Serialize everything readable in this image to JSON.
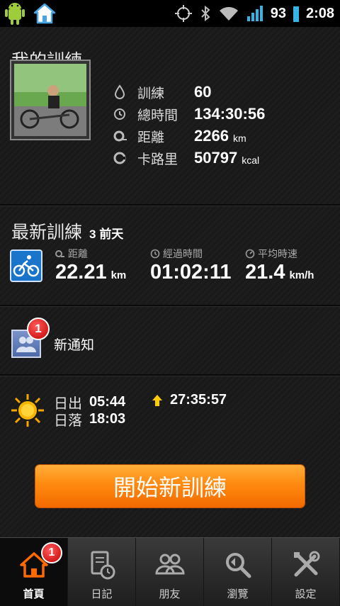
{
  "status_bar": {
    "battery": "93",
    "time": "2:08"
  },
  "my_training": {
    "title": "我的訓練",
    "stats": [
      {
        "label": "訓練",
        "value": "60",
        "unit": "",
        "icon": "drop-icon"
      },
      {
        "label": "總時間",
        "value": "134:30:56",
        "unit": "",
        "icon": "clock-icon"
      },
      {
        "label": "距離",
        "value": "2266",
        "unit": "km",
        "icon": "distance-icon"
      },
      {
        "label": "卡路里",
        "value": "50797",
        "unit": "kcal",
        "icon": "calorie-icon"
      }
    ]
  },
  "latest_training": {
    "title": "最新訓練",
    "ago": "3 前天",
    "metrics": [
      {
        "label": "距離",
        "value": "22.21",
        "unit": "km"
      },
      {
        "label": "經過時間",
        "value": "01:02:11",
        "unit": ""
      },
      {
        "label": "平均時速",
        "value": "21.4",
        "unit": "km/h"
      }
    ]
  },
  "notifications": {
    "label": "新通知",
    "badge": "1"
  },
  "sun": {
    "sunrise_label": "日出",
    "sunrise": "05:44",
    "sunset_label": "日落",
    "sunset": "18:03",
    "daylight": "27:35:57"
  },
  "start_button": "開始新訓練",
  "tabs": [
    {
      "label": "首頁",
      "badge": "1",
      "icon": "home-icon",
      "active": true
    },
    {
      "label": "日記",
      "icon": "diary-icon"
    },
    {
      "label": "朋友",
      "icon": "friends-icon"
    },
    {
      "label": "瀏覽",
      "icon": "browse-icon"
    },
    {
      "label": "設定",
      "icon": "settings-icon"
    }
  ],
  "colors": {
    "accent": "#ff8a10",
    "badge": "#d40000",
    "background": "#141414"
  }
}
